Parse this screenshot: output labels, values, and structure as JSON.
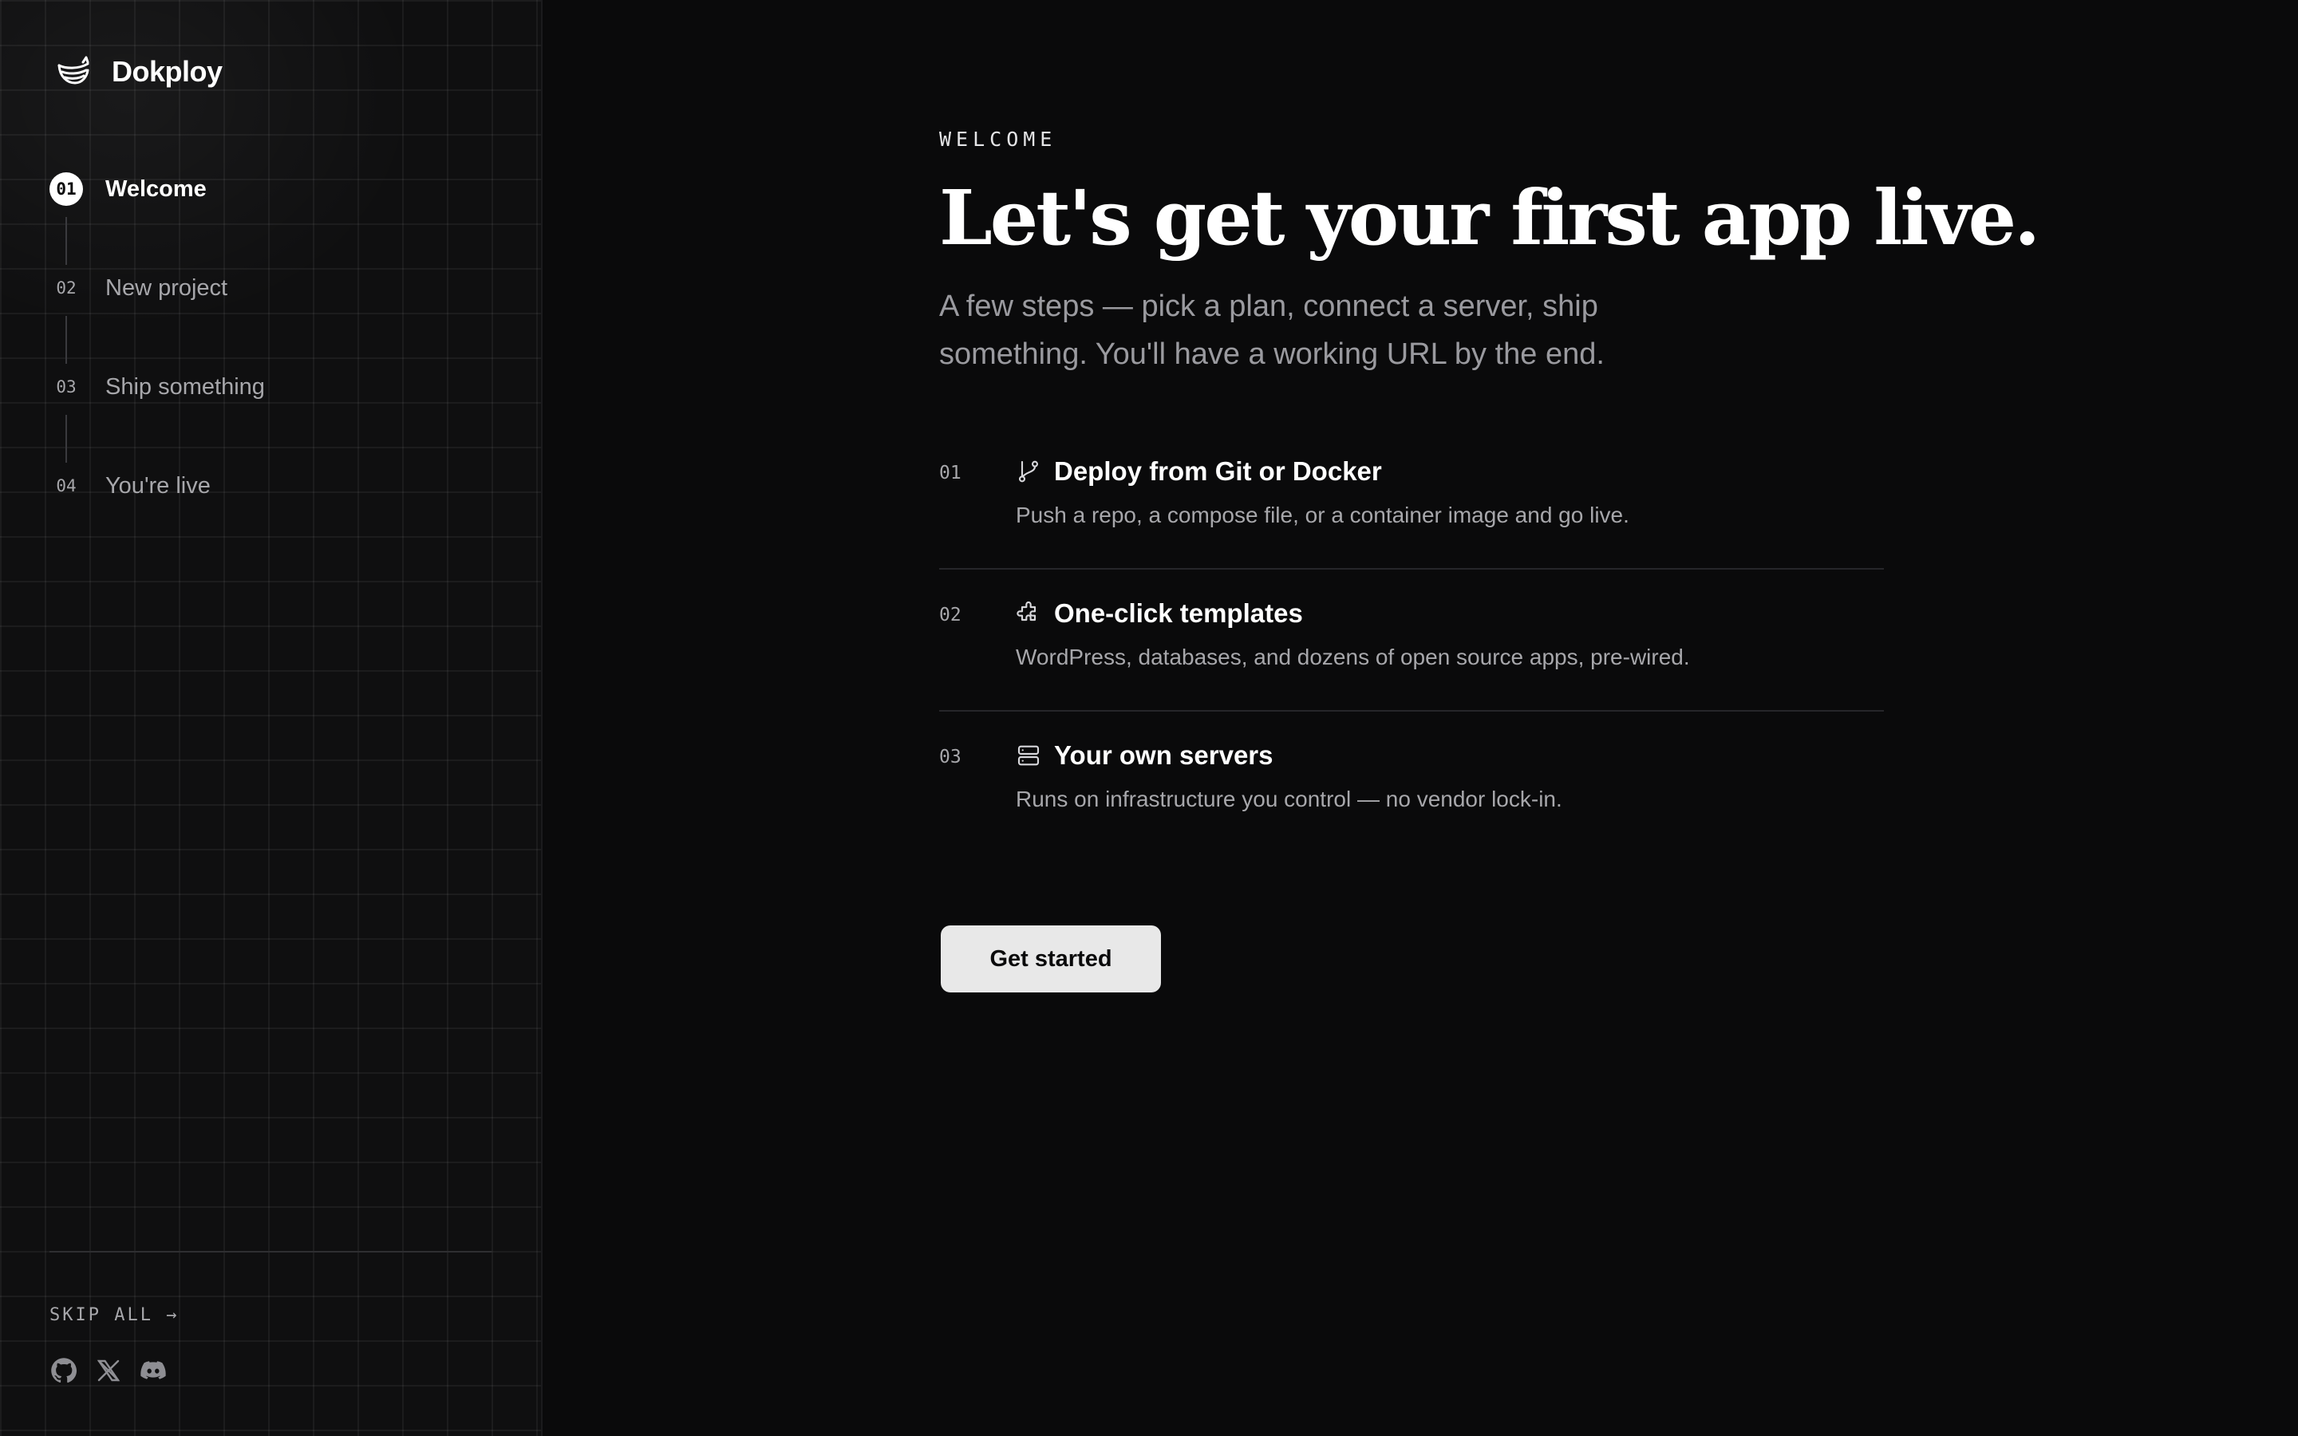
{
  "brand": {
    "name": "Dokploy",
    "logo_icon": "dokploy-whale-icon"
  },
  "steps": [
    {
      "number": "01",
      "label": "Welcome",
      "active": true
    },
    {
      "number": "02",
      "label": "New project",
      "active": false
    },
    {
      "number": "03",
      "label": "Ship something",
      "active": false
    },
    {
      "number": "04",
      "label": "You're live",
      "active": false
    }
  ],
  "sidebar_footer": {
    "skip_label": "SKIP ALL →",
    "socials": [
      "github-icon",
      "x-icon",
      "discord-icon"
    ]
  },
  "main": {
    "eyebrow": "WELCOME",
    "headline": "Let's get your first app live.",
    "subhead": "A few steps — pick a plan, connect a server, ship something. You'll have a working URL by the end.",
    "features": [
      {
        "number": "01",
        "icon": "git-branch-icon",
        "title": "Deploy from Git or Docker",
        "description": "Push a repo, a compose file, or a container image and go live."
      },
      {
        "number": "02",
        "icon": "puzzle-icon",
        "title": "One-click templates",
        "description": "WordPress, databases, and dozens of open source apps, pre-wired."
      },
      {
        "number": "03",
        "icon": "server-icon",
        "title": "Your own servers",
        "description": "Runs on infrastructure you control — no vendor lock-in."
      }
    ],
    "cta_label": "Get started"
  },
  "colors": {
    "background": "#0a0a0b",
    "sidebar_background": "#0f0f10",
    "text_primary": "#ffffff",
    "text_muted": "#a7a7ab",
    "button_background": "#e8e8e8"
  }
}
